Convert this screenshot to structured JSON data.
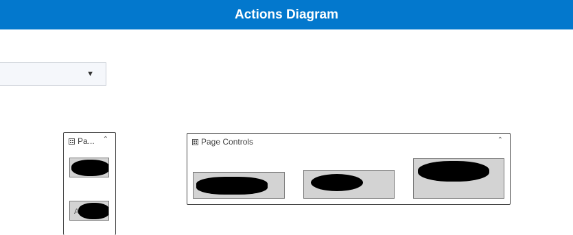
{
  "header": {
    "title": "Actions Diagram"
  },
  "dropdown": {
    "value": "",
    "caret": "▼"
  },
  "panels": [
    {
      "title": "Pa...",
      "collapse_glyph": "⌃",
      "buttons": [
        {
          "label": ""
        },
        {
          "label": "A"
        }
      ]
    },
    {
      "title": "Page Controls",
      "collapse_glyph": "⌃",
      "buttons": [
        {
          "label": ""
        },
        {
          "label": ""
        },
        {
          "label": ""
        }
      ]
    }
  ],
  "colors": {
    "title_bar": "#0378cd",
    "button_fill": "#d3d3d3"
  }
}
